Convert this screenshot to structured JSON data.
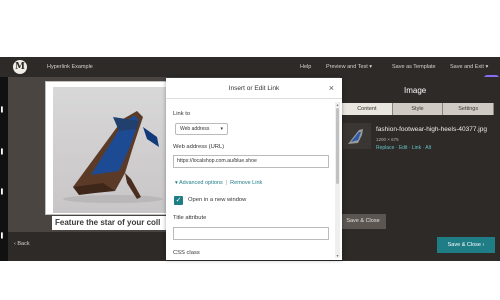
{
  "topbar": {
    "site_name": "Hyperlink Example",
    "help": "Help",
    "preview_test": "Preview and Test ▾",
    "save_template": "Save as Template",
    "save_exit": "Save and Exit ▾"
  },
  "canvas": {
    "caption": "Feature the star of your coll"
  },
  "image_panel": {
    "title": "Image",
    "tabs": [
      "Content",
      "Style",
      "Settings"
    ],
    "filename": "fashion-footwear-high-heels-40377.jpg",
    "dimensions": "1200 × 675",
    "links": [
      "Replace",
      "Edit",
      "Link",
      "Alt"
    ]
  },
  "save_close_behind": "Save & Close",
  "bottom": {
    "back": "Back",
    "save_close": "Save & Close"
  },
  "extension": {
    "label": "S",
    "color": "#8a6cf0"
  },
  "dialog": {
    "title": "Insert or Edit Link",
    "close": "×",
    "link_to_label": "Link to",
    "link_to_value": "Web address",
    "url_label": "Web address (URL)",
    "url_value": "https://localshop.com.au/blue.shoe",
    "advanced_options": "Advanced options",
    "remove_link": "Remove Link",
    "new_window_label": "Open in a new window",
    "new_window_checked": true,
    "title_attr_label": "Title attribute",
    "title_attr_value": "",
    "css_class_label": "CSS class"
  },
  "colors": {
    "topbar": "#2d2a27",
    "accent": "#1f7d86"
  }
}
